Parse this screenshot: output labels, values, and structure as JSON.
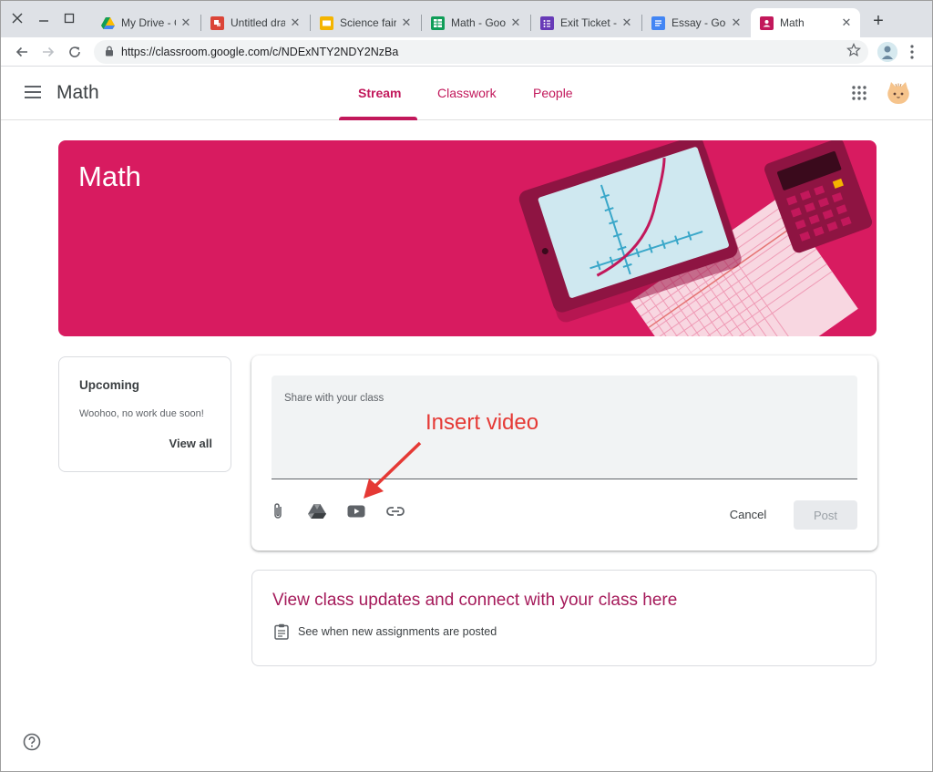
{
  "browser": {
    "tabs": [
      {
        "title": "My Drive - Go",
        "favicon": "google-drive-icon",
        "color": "#4285f4"
      },
      {
        "title": "Untitled draw",
        "favicon": "google-drawings-icon",
        "color": "#db4437"
      },
      {
        "title": "Science fair -",
        "favicon": "google-slides-icon",
        "color": "#f4b400"
      },
      {
        "title": "Math - Googl",
        "favicon": "google-sheets-icon",
        "color": "#0f9d58"
      },
      {
        "title": "Exit Ticket - C",
        "favicon": "google-forms-icon",
        "color": "#673ab7"
      },
      {
        "title": "Essay - Goog",
        "favicon": "google-docs-icon",
        "color": "#4285f4"
      },
      {
        "title": "Math",
        "favicon": "google-classroom-icon",
        "color": "#c2185b",
        "active": true
      }
    ],
    "url": "https://classroom.google.com/c/NDExNTY2NDY2NzBa"
  },
  "app": {
    "class_name": "Math",
    "nav": {
      "stream": "Stream",
      "classwork": "Classwork",
      "people": "People"
    }
  },
  "banner": {
    "title": "Math",
    "color": "#d81b60"
  },
  "upcoming": {
    "heading": "Upcoming",
    "empty_message": "Woohoo, no work due soon!",
    "view_all": "View all"
  },
  "composer": {
    "placeholder": "Share with your class",
    "cancel_label": "Cancel",
    "post_label": "Post"
  },
  "annotation": {
    "text": "Insert video",
    "color": "#e53935"
  },
  "updates": {
    "headline": "View class updates and connect with your class here",
    "row_text": "See when new assignments are posted"
  },
  "accent_color": "#c2185b"
}
